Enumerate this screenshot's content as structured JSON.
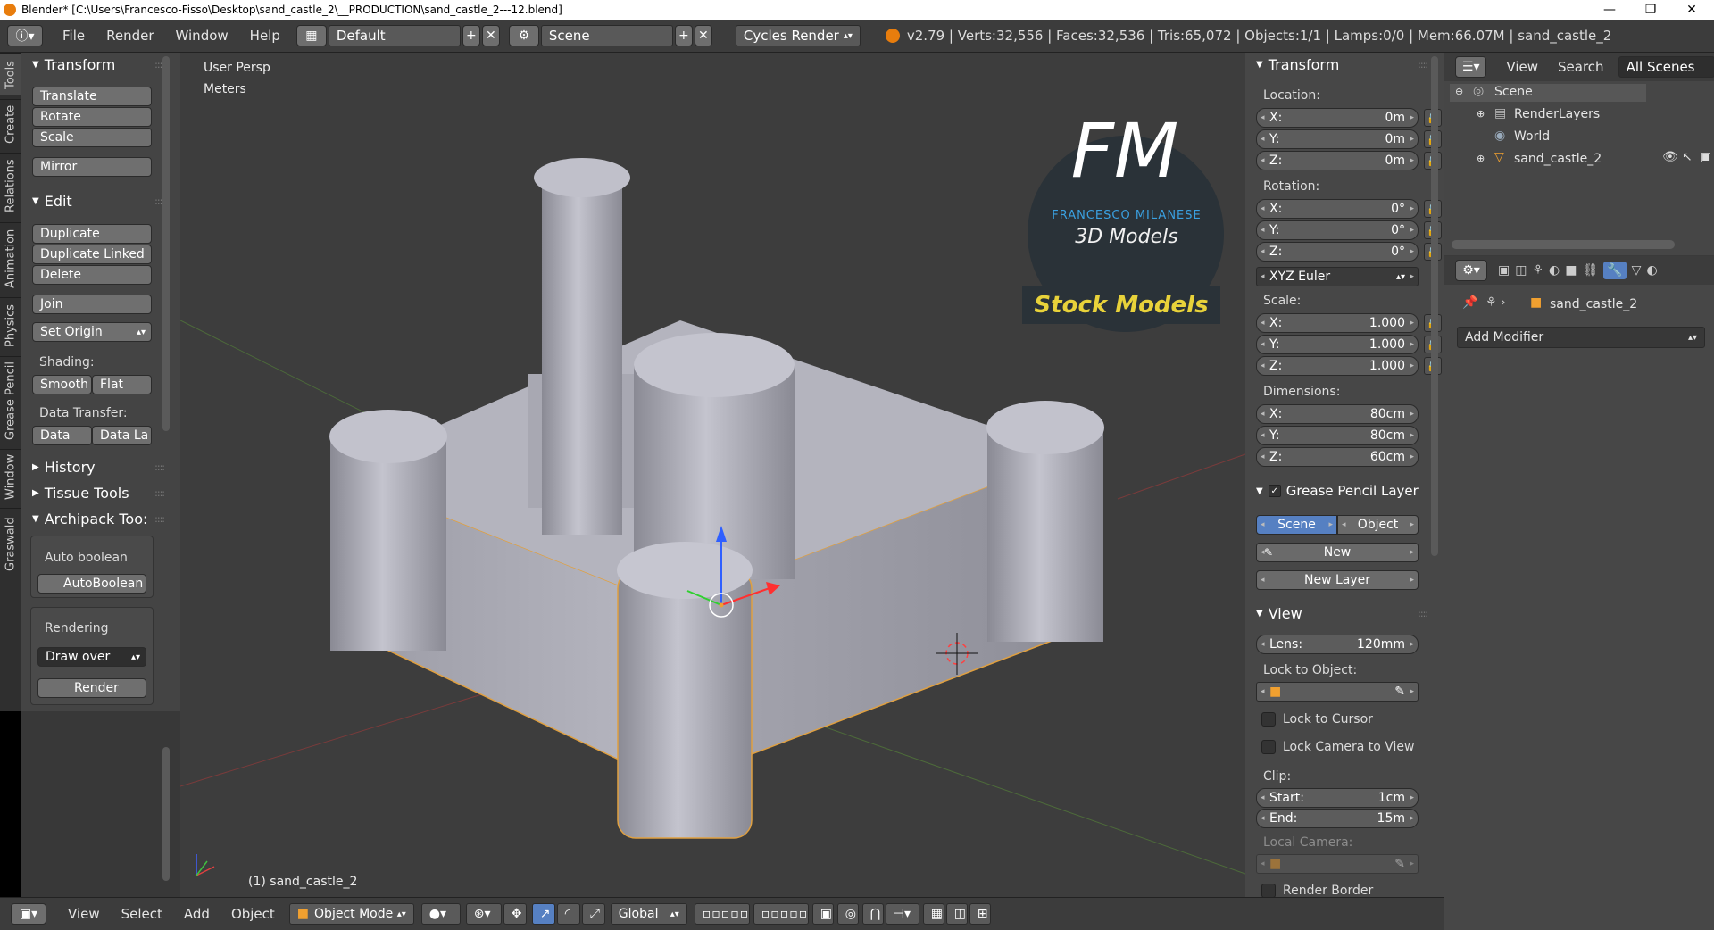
{
  "window": {
    "title": "Blender* [C:\\Users\\Francesco-Fisso\\Desktop\\sand_castle_2\\__PRODUCTION\\sand_castle_2---12.blend]",
    "minimize": "—",
    "maximize": "❐",
    "close": "✕"
  },
  "topbar": {
    "menus": [
      "File",
      "Render",
      "Window",
      "Help"
    ],
    "layout": "Default",
    "scene": "Scene",
    "engine": "Cycles Render",
    "stats": "v2.79 | Verts:32,556 | Faces:32,536 | Tris:65,072 | Objects:1/1 | Lamps:0/0 | Mem:66.07M | sand_castle_2"
  },
  "left_tabs": [
    "Tools",
    "Create",
    "Relations",
    "Animation",
    "Physics",
    "Grease Pencil",
    "Window",
    "Graswald"
  ],
  "toolshelf": {
    "transform": {
      "title": "Transform",
      "buttons": [
        "Translate",
        "Rotate",
        "Scale",
        "Mirror"
      ]
    },
    "edit": {
      "title": "Edit",
      "buttons": [
        "Duplicate",
        "Duplicate Linked",
        "Delete",
        "Join"
      ],
      "set_origin": "Set Origin",
      "shading_label": "Shading:",
      "smooth": "Smooth",
      "flat": "Flat",
      "data_transfer_label": "Data Transfer:",
      "data": "Data",
      "data_la": "Data La"
    },
    "history": "History",
    "tissue": "Tissue Tools",
    "archipack": {
      "title": "Archipack Too:",
      "auto_boolean_label": "Auto boolean",
      "auto_boolean_btn": "AutoBoolean",
      "rendering_label": "Rendering",
      "draw_over": "Draw over",
      "render": "Render"
    }
  },
  "viewport": {
    "view_name": "User Persp",
    "units": "Meters",
    "object_label": "(1) sand_castle_2",
    "logo_fm": "FM",
    "logo_name": "FRANCESCO MILANESE",
    "logo_sub": "3D Models",
    "stock": "Stock Models"
  },
  "npanel": {
    "transform_title": "Transform",
    "location_label": "Location:",
    "location": [
      {
        "k": "X:",
        "v": "0m"
      },
      {
        "k": "Y:",
        "v": "0m"
      },
      {
        "k": "Z:",
        "v": "0m"
      }
    ],
    "rotation_label": "Rotation:",
    "rotation": [
      {
        "k": "X:",
        "v": "0°"
      },
      {
        "k": "Y:",
        "v": "0°"
      },
      {
        "k": "Z:",
        "v": "0°"
      }
    ],
    "rotation_mode": "XYZ Euler",
    "scale_label": "Scale:",
    "scale": [
      {
        "k": "X:",
        "v": "1.000"
      },
      {
        "k": "Y:",
        "v": "1.000"
      },
      {
        "k": "Z:",
        "v": "1.000"
      }
    ],
    "dimensions_label": "Dimensions:",
    "dimensions": [
      {
        "k": "X:",
        "v": "80cm"
      },
      {
        "k": "Y:",
        "v": "80cm"
      },
      {
        "k": "Z:",
        "v": "60cm"
      }
    ],
    "grease_title": "Grease Pencil Layer",
    "scene_btn": "Scene",
    "object_btn": "Object",
    "new_btn": "New",
    "new_layer_btn": "New Layer",
    "view_title": "View",
    "lens": {
      "k": "Lens:",
      "v": "120mm"
    },
    "lock_object_label": "Lock to Object:",
    "lock_cursor": "Lock to Cursor",
    "lock_camera": "Lock Camera to View",
    "clip_label": "Clip:",
    "clip_start": {
      "k": "Start:",
      "v": "1cm"
    },
    "clip_end": {
      "k": "End:",
      "v": "15m"
    },
    "local_camera_label": "Local Camera:",
    "render_border": "Render Border"
  },
  "outliner": {
    "view": "View",
    "search": "Search",
    "filter": "All Scenes",
    "items": [
      "Scene",
      "RenderLayers",
      "World",
      "sand_castle_2"
    ]
  },
  "properties": {
    "object_name": "sand_castle_2",
    "add_modifier": "Add Modifier"
  },
  "bottombar": {
    "menus": [
      "View",
      "Select",
      "Add",
      "Object"
    ],
    "mode": "Object Mode",
    "orientation": "Global"
  },
  "colors": {
    "accent_blue": "#5680c2",
    "selection_orange": "#f0a030",
    "logo_yellow": "#e8d23a",
    "logo_blue": "#3aa0e0"
  }
}
